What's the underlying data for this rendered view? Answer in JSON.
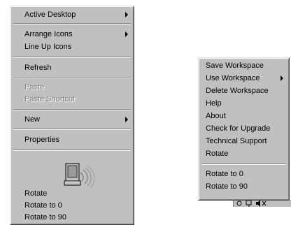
{
  "desktop_menu": {
    "items": [
      {
        "label": "Active Desktop",
        "submenu": true,
        "disabled": false
      },
      {
        "label": "Arrange Icons",
        "submenu": true,
        "disabled": false
      },
      {
        "label": "Line Up Icons",
        "submenu": false,
        "disabled": false
      },
      {
        "label": "Refresh",
        "submenu": false,
        "disabled": false
      },
      {
        "label": "Paste",
        "submenu": false,
        "disabled": true
      },
      {
        "label": "Paste Shortcut",
        "submenu": false,
        "disabled": true
      },
      {
        "label": "New",
        "submenu": true,
        "disabled": false
      },
      {
        "label": "Properties",
        "submenu": false,
        "disabled": false
      },
      {
        "label": "Rotate",
        "submenu": false,
        "disabled": false
      },
      {
        "label": "Rotate to 0",
        "submenu": false,
        "disabled": false
      },
      {
        "label": "Rotate to 90",
        "submenu": false,
        "disabled": false
      }
    ],
    "icon": "rotating-monitor-icon"
  },
  "workspace_menu": {
    "items": [
      {
        "label": "Save Workspace",
        "submenu": false
      },
      {
        "label": "Use Workspace",
        "submenu": true
      },
      {
        "label": "Delete Workspace",
        "submenu": false
      },
      {
        "label": "Help",
        "submenu": false
      },
      {
        "label": "About",
        "submenu": false
      },
      {
        "label": "Check for Upgrade",
        "submenu": false
      },
      {
        "label": "Technical Support",
        "submenu": false
      },
      {
        "label": "Rotate",
        "submenu": false
      },
      {
        "label": "Rotate to 0",
        "submenu": false
      },
      {
        "label": "Rotate to 90",
        "submenu": false
      }
    ]
  },
  "taskbar": {
    "tray_icons": [
      "rotate-tray-icon",
      "network-tray-icon",
      "volume-tray-icon"
    ]
  },
  "colors": {
    "menu_bg": "#c0c0c0",
    "shadow": "#808080",
    "highlight": "#ffffff",
    "disabled_text": "#808080"
  }
}
